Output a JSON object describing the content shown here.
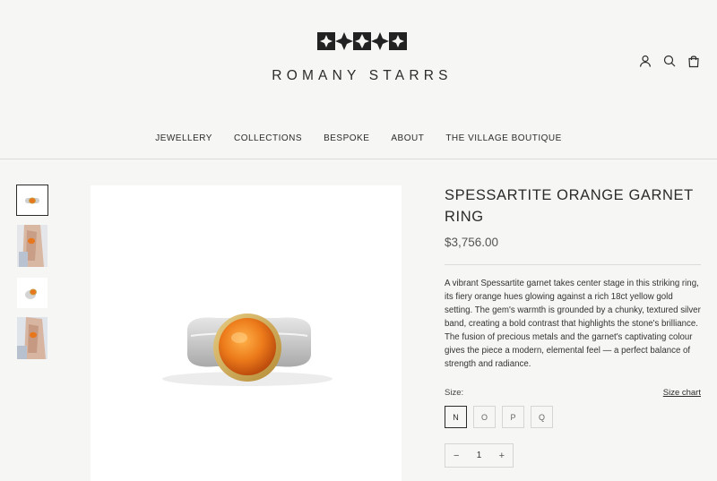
{
  "brand": {
    "name": "ROMANY STARRS",
    "logo_icon": "romany-starrs-logo-icon"
  },
  "header_icons": [
    {
      "name": "account-icon"
    },
    {
      "name": "search-icon"
    },
    {
      "name": "bag-icon"
    }
  ],
  "nav": {
    "items": [
      "JEWELLERY",
      "COLLECTIONS",
      "BESPOKE",
      "ABOUT",
      "THE VILLAGE BOUTIQUE"
    ]
  },
  "gallery": {
    "thumbnails": [
      "ring-front",
      "ring-on-hand",
      "ring-angle",
      "ring-on-hand-side"
    ],
    "active_index": 0,
    "main_image": "spessartite-garnet-ring"
  },
  "product": {
    "title": "SPESSARTITE ORANGE GARNET RING",
    "price": "$3,756.00",
    "description": "A vibrant Spessartite garnet takes center stage in this striking ring, its fiery orange hues glowing against a rich 18ct yellow gold setting. The gem's warmth is grounded by a chunky, textured silver band, creating a bold contrast that highlights the stone's brilliance. The fusion of precious metals and the garnet's captivating colour gives the piece a modern, elemental feel — a perfect balance of strength and radiance.",
    "size_label": "Size:",
    "size_chart_label": "Size chart",
    "sizes": [
      "N",
      "O",
      "P",
      "Q"
    ],
    "selected_size": "N",
    "quantity": "1",
    "qty_minus": "−",
    "qty_plus": "+"
  },
  "colors": {
    "accent": "#2b2b2b",
    "background": "#f6f6f4",
    "garnet": "#e8761c",
    "gold": "#c9a24a"
  }
}
